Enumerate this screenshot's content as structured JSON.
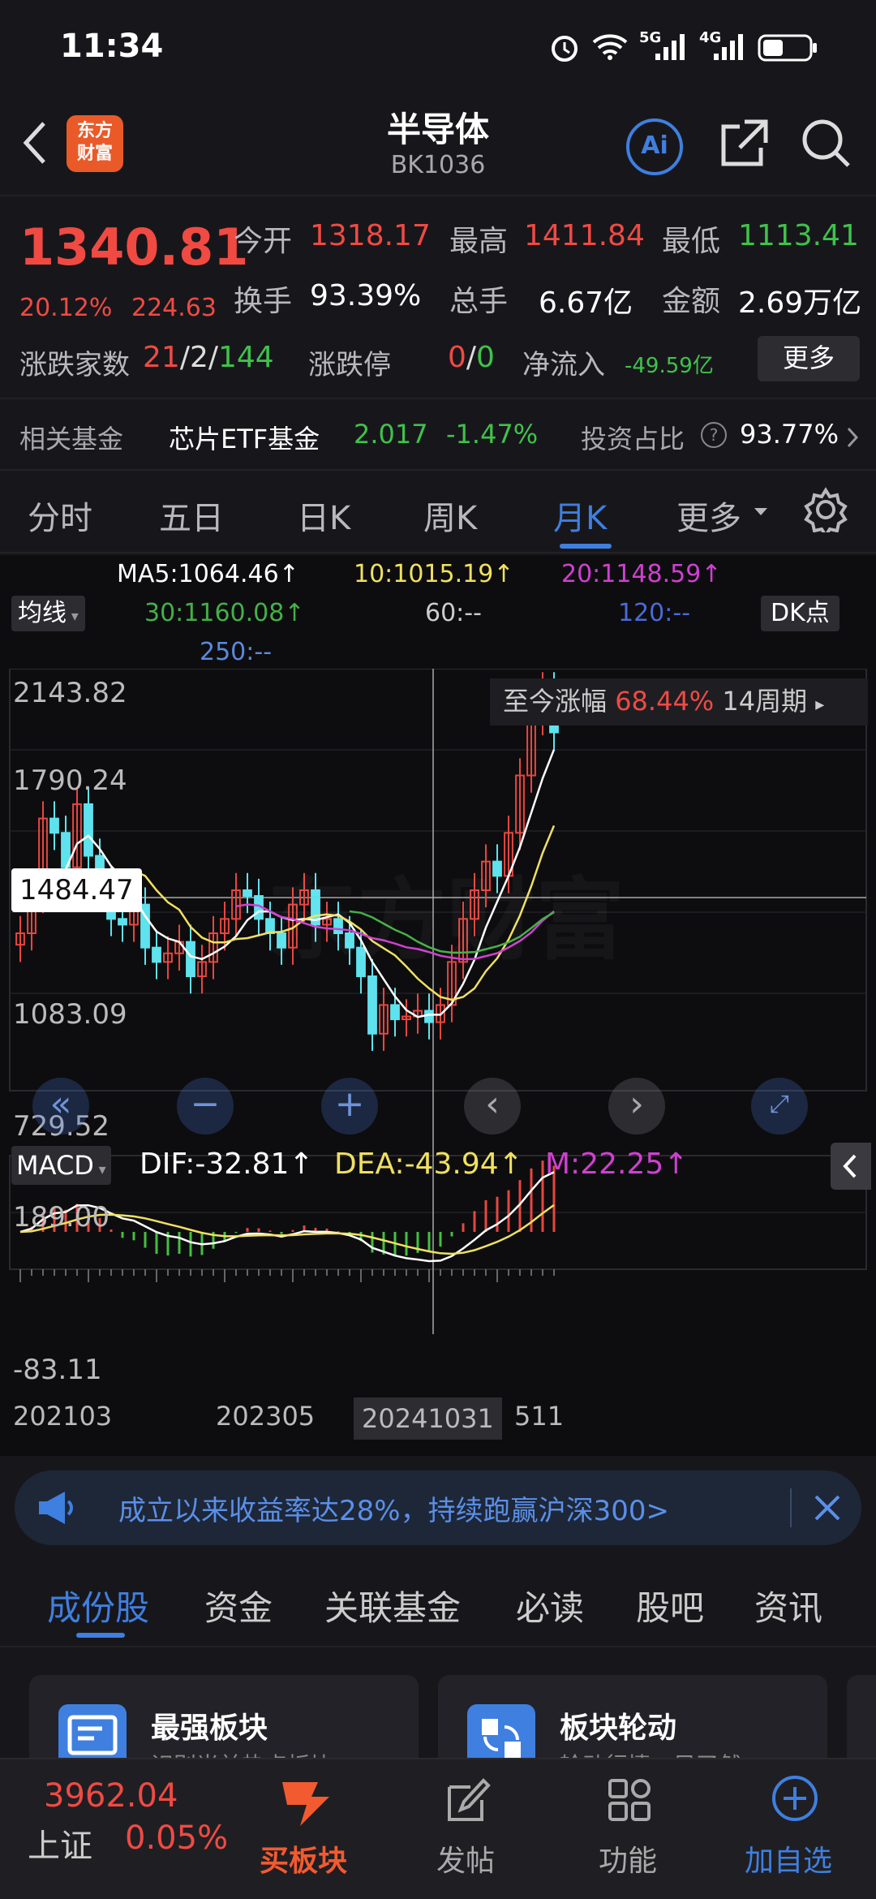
{
  "status_bar": {
    "time": "11:34",
    "signal_5g": "5G",
    "signal_4g": "4G"
  },
  "header": {
    "title": "半导体",
    "code": "BK1036",
    "logo_text_1": "东方",
    "logo_text_2": "财富",
    "ai_label": "Ai"
  },
  "quote": {
    "price": "1340.81",
    "change_pct": "20.12%",
    "change_amt": "224.63",
    "open_label": "今开",
    "open": "1318.17",
    "high_label": "最高",
    "high": "1411.84",
    "low_label": "最低",
    "low": "1113.41",
    "turnover_label": "换手",
    "turnover": "93.39%",
    "volume_label": "总手",
    "volume": "6.67亿",
    "amount_label": "金额",
    "amount": "2.69万亿",
    "updown_label": "涨跌家数",
    "up_count": "21",
    "flat_count": "2",
    "down_count": "144",
    "limit_label": "涨跌停",
    "limit_up": "0",
    "limit_down": "0",
    "netflow_label": "净流入",
    "netflow": "-49.59亿",
    "more": "更多"
  },
  "fund": {
    "label": "相关基金",
    "name": "芯片ETF基金",
    "price": "2.017",
    "change": "-1.47%",
    "ratio_label": "投资占比",
    "ratio": "93.77%"
  },
  "ktabs": [
    {
      "label": "分时"
    },
    {
      "label": "五日"
    },
    {
      "label": "日K"
    },
    {
      "label": "周K"
    },
    {
      "label": "月K",
      "active": true
    },
    {
      "label": "更多"
    }
  ],
  "indicators": {
    "ma5": "MA5:1064.46↑",
    "ma10": "10:1015.19↑",
    "ma20": "20:1148.59↑",
    "ma30": "30:1160.08↑",
    "ma60": "60:--",
    "ma120": "120:--",
    "ma250": "250:--",
    "ma_select": "均线",
    "dk": "DK点"
  },
  "chart_data": {
    "type": "candlestick",
    "price_axis": [
      "2143.82",
      "1790.24",
      "1083.09",
      "729.52"
    ],
    "crosshair_value": "1484.47",
    "period_info": {
      "label": "至今涨幅",
      "value": "68.44%",
      "period": "14周期"
    },
    "macd": {
      "selector": "MACD",
      "dif": "DIF:-32.81↑",
      "dea": "DEA:-43.94↑",
      "m": "M:22.25↑",
      "axis_top": "189.00",
      "axis_bottom": "-83.11"
    },
    "x_labels": [
      "202103",
      "202305",
      "20241031",
      "511"
    ],
    "colors": {
      "up": "#e8463f",
      "down": "#5ee3ee",
      "ma5": "#ffffff",
      "ma10": "#f0e060",
      "ma20": "#d040d0",
      "ma30": "#44b048"
    }
  },
  "banner": {
    "text": "成立以来收益率达28%，持续跑赢沪深300>"
  },
  "bottom_tabs": [
    {
      "label": "成份股",
      "active": true
    },
    {
      "label": "资金"
    },
    {
      "label": "关联基金"
    },
    {
      "label": "必读"
    },
    {
      "label": "股吧"
    },
    {
      "label": "资讯"
    }
  ],
  "cards": [
    {
      "title": "最强板块",
      "subtitle": "识别当前热点板块"
    },
    {
      "title": "板块轮动",
      "subtitle": "轮动行情一目了然"
    }
  ],
  "tabbar": {
    "index_value": "3962.04",
    "index_name": "上证",
    "index_change": "0.05%",
    "buy": "买板块",
    "post": "发帖",
    "function": "功能",
    "add": "加自选"
  }
}
